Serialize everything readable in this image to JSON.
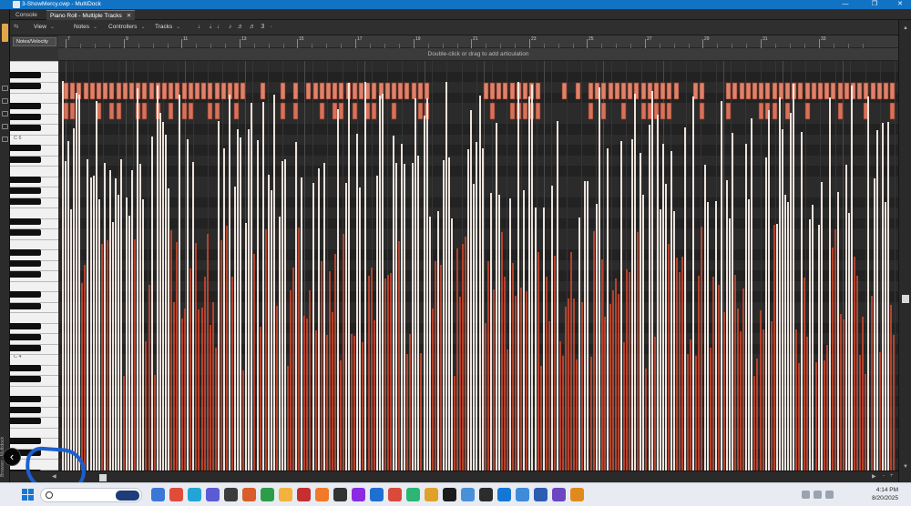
{
  "window": {
    "title": "3-ShowMercy.cwp - MultiDock",
    "controls": [
      "—",
      "❐",
      "✕"
    ]
  },
  "tabs": [
    {
      "label": "Console",
      "active": false
    },
    {
      "label": "Piano Roll - Multiple Tracks",
      "active": true,
      "close": "✕"
    }
  ],
  "toolbar": {
    "menus": [
      "View",
      "Notes",
      "Controllers",
      "Tracks"
    ],
    "note_glyphs": "♩ 𝅗𝅥 ♩ ♪ ♬ ♬ 3 ·",
    "caret": "⌄"
  },
  "ruler": {
    "numbers": [
      "7",
      "9",
      "11",
      "13",
      "15",
      "17",
      "19",
      "21",
      "23",
      "25",
      "27",
      "29",
      "31",
      "33"
    ]
  },
  "controller_pane": {
    "dropdown_value": "Notes/Velocity",
    "articulation_hint": "Double-click or drag to add articulation"
  },
  "keyboard": {
    "labels": [
      {
        "text": "C 6"
      },
      {
        "text": "C 4"
      }
    ]
  },
  "side_panel": {
    "label": "Browser · Multidock"
  },
  "taskbar": {
    "time": "4:14 PM",
    "date": "8/20/2025"
  },
  "colors": {
    "accent_blue": "#1273c4",
    "note_orange": "#e0826a",
    "velocity_light": "#f7ece6",
    "velocity_dark": "#c2462f",
    "annotation_blue": "#1b5fd1"
  },
  "icons": [
    "app-icon",
    "chevron-left-icon",
    "search-icon",
    "windows-start-icon"
  ]
}
